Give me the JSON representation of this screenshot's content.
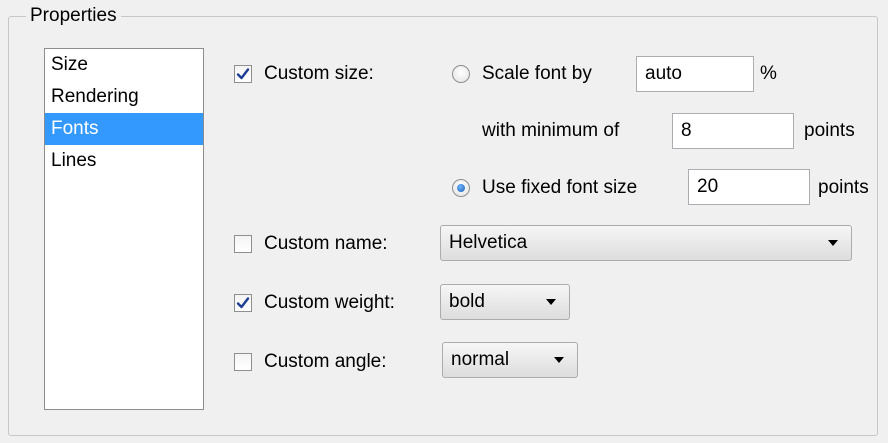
{
  "groupbox": {
    "title": "Properties"
  },
  "categories": {
    "items": [
      "Size",
      "Rendering",
      "Fonts",
      "Lines"
    ],
    "selected": "Fonts"
  },
  "custom_size": {
    "label": "Custom size:",
    "checked": true,
    "scale": {
      "label": "Scale font by",
      "selected": false,
      "value": "auto",
      "suffix": "%",
      "min_label": "with minimum of",
      "min_value": "8",
      "min_unit": "points"
    },
    "fixed": {
      "label": "Use fixed font size",
      "selected": true,
      "value": "20",
      "unit": "points"
    }
  },
  "custom_name": {
    "label": "Custom name:",
    "checked": false,
    "value": "Helvetica"
  },
  "custom_weight": {
    "label": "Custom weight:",
    "checked": true,
    "value": "bold"
  },
  "custom_angle": {
    "label": "Custom angle:",
    "checked": false,
    "value": "normal"
  },
  "colors": {
    "selection": "#3399ff",
    "panel": "#f0f0f0",
    "check_blue": "#1c3f94"
  },
  "icons": {
    "checkmark": "check-icon",
    "radio_dot": "radio-dot-icon",
    "dropdown": "chevron-down-icon"
  }
}
